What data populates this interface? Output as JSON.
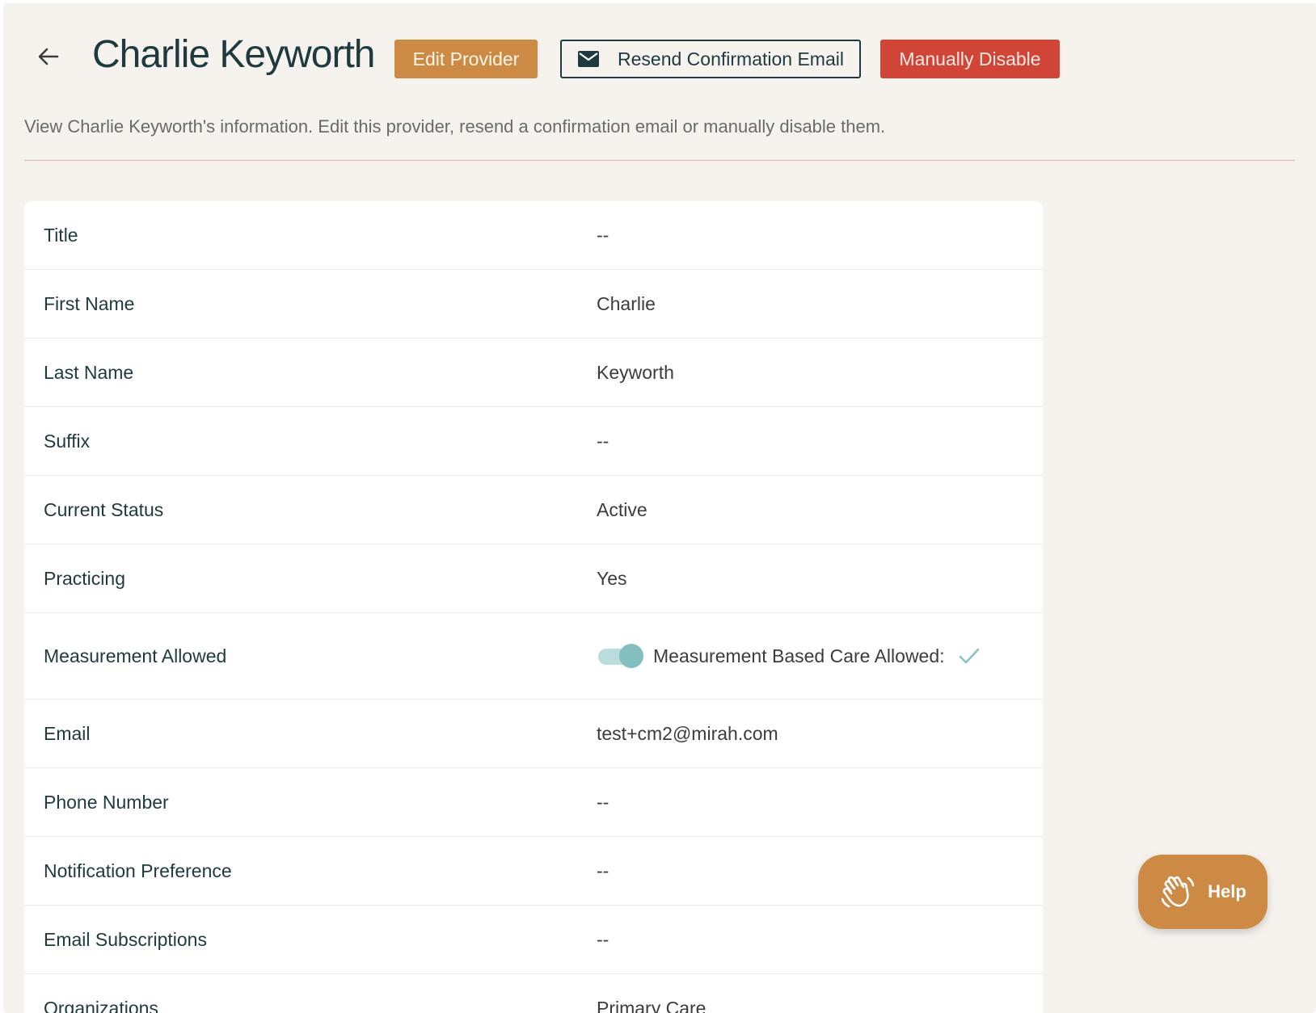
{
  "header": {
    "title": "Charlie Keyworth",
    "edit_label": "Edit Provider",
    "resend_label": "Resend Confirmation Email",
    "disable_label": "Manually Disable",
    "subtitle": "View Charlie Keyworth's information. Edit this provider, resend a confirmation email or manually disable them."
  },
  "details": {
    "rows": [
      {
        "label": "Title",
        "value": "--"
      },
      {
        "label": "First Name",
        "value": "Charlie"
      },
      {
        "label": "Last Name",
        "value": "Keyworth"
      },
      {
        "label": "Suffix",
        "value": "--"
      },
      {
        "label": "Current Status",
        "value": "Active"
      },
      {
        "label": "Practicing",
        "value": "Yes"
      },
      {
        "label": "Measurement Allowed",
        "value": "Measurement Based Care Allowed:"
      },
      {
        "label": "Email",
        "value": "test+cm2@mirah.com"
      },
      {
        "label": "Phone Number",
        "value": "--"
      },
      {
        "label": "Notification Preference",
        "value": "--"
      },
      {
        "label": "Email Subscriptions",
        "value": "--"
      },
      {
        "label": "Organizations",
        "value": "Primary Care"
      }
    ],
    "measurement_toggle_on": true
  },
  "help": {
    "label": "Help"
  },
  "icons": {
    "back": "arrow-left-icon",
    "mail": "mail-icon",
    "check": "check-icon",
    "help": "waving-hand-icon"
  },
  "colors": {
    "accent": "#cc8a45",
    "danger": "#d04536",
    "primary_text": "#1f3a3f",
    "background": "#f6f3ef",
    "toggle": "#83bfbf"
  }
}
